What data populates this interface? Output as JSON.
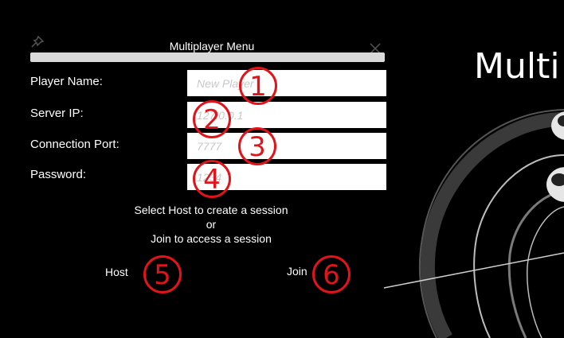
{
  "scene": {
    "title": "Multi"
  },
  "menu": {
    "title": "Multiplayer Menu",
    "pin_icon": "pin-icon",
    "close_icon": "close-icon",
    "fields": {
      "player_name": {
        "label": "Player Name:",
        "placeholder": "New Player"
      },
      "server_ip": {
        "label": "Server IP:",
        "placeholder": "127.0.0.1"
      },
      "connection_port": {
        "label": "Connection Port:",
        "placeholder": "7777"
      },
      "password": {
        "label": "Password:",
        "placeholder": "1234"
      }
    },
    "instructions": {
      "line1": "Select Host to create a session",
      "line2": "or",
      "line3": "Join to access a session"
    },
    "host_label": "Host",
    "join_label": "Join"
  },
  "annotations": [
    "1",
    "2",
    "3",
    "4",
    "5",
    "6"
  ],
  "colors": {
    "annotation": "#e0141a",
    "titlebar": "#d9d9d9",
    "background": "#000000"
  }
}
